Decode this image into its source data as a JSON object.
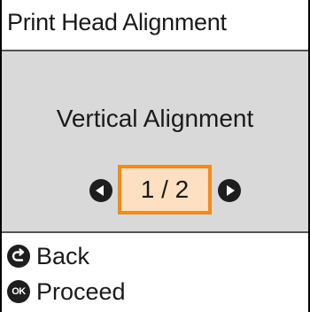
{
  "header": {
    "title": "Print Head Alignment"
  },
  "main": {
    "heading": "Vertical Alignment",
    "pager": {
      "current": "1",
      "separator": "/",
      "total": "2",
      "prev_icon": "triangle-left-icon",
      "next_icon": "triangle-right-icon"
    }
  },
  "footer": {
    "back": {
      "icon": "back-icon",
      "label": "Back"
    },
    "proceed": {
      "icon": "ok-icon",
      "icon_text": "OK",
      "label": "Proceed"
    }
  },
  "colors": {
    "highlight_border": "#f28a1c",
    "highlight_fill": "#fddfc2",
    "content_bg": "#d9d9d9",
    "icon_bg": "#1e1e1e"
  }
}
